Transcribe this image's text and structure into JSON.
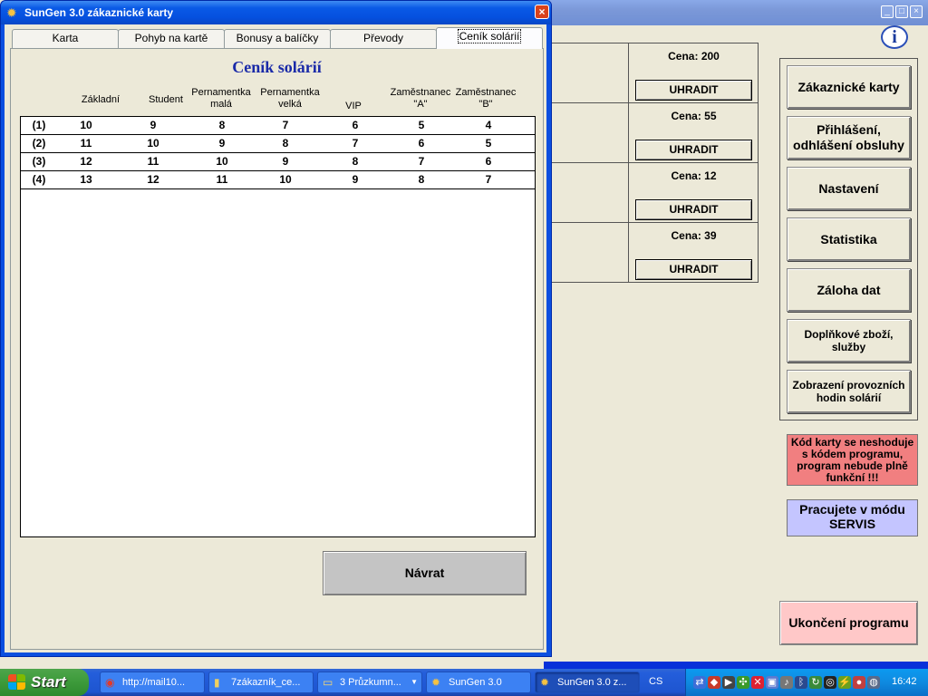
{
  "main_window": {
    "title_buttons": {
      "min": "_",
      "max": "□",
      "close": "×"
    },
    "info_button": "i",
    "prices": [
      {
        "price": "Cena: 200",
        "pay": "UHRADIT"
      },
      {
        "price": "Cena: 55",
        "pay": "UHRADIT"
      },
      {
        "price": "Cena: 12",
        "pay": "UHRADIT"
      },
      {
        "price": "Cena: 39",
        "pay": "UHRADIT"
      }
    ],
    "menu": [
      "Zákaznické karty",
      "Přihlášení, odhlášení obsluhy",
      "Nastavení",
      "Statistika",
      "Záloha dat",
      "Doplňkové zboží, služby",
      "Zobrazení provozních hodin solárií"
    ],
    "warning": "Kód karty se neshoduje s kódem programu, program nebude plně funkční !!!",
    "mode": "Pracujete v módu SERVIS",
    "quit": "Ukončení programu"
  },
  "dialog": {
    "title": "SunGen 3.0 zákaznické karty",
    "close": "×",
    "tabs": [
      "Karta",
      "Pohyb na kartě",
      "Bonusy a balíčky",
      "Převody",
      "Ceník solárií"
    ],
    "active_tab": "Ceník solárií",
    "panel_title": "Ceník solárií",
    "columns": [
      "Základní",
      "Student",
      "Pernamentka\nmalá",
      "Pernamentka\nvelká",
      "VIP",
      "Zaměstnanec\n\"A\"",
      "Zaměstnanec\n\"B\""
    ],
    "rows": [
      {
        "label": "(1)",
        "values": [
          "10",
          "9",
          "8",
          "7",
          "6",
          "5",
          "4"
        ]
      },
      {
        "label": "(2)",
        "values": [
          "11",
          "10",
          "9",
          "8",
          "7",
          "6",
          "5"
        ]
      },
      {
        "label": "(3)",
        "values": [
          "12",
          "11",
          "10",
          "9",
          "8",
          "7",
          "6"
        ]
      },
      {
        "label": "(4)",
        "values": [
          "13",
          "12",
          "11",
          "10",
          "9",
          "8",
          "7"
        ]
      }
    ],
    "back_button": "Návrat"
  },
  "taskbar": {
    "start": "Start",
    "buttons": [
      {
        "label": "http://mail10...",
        "icon": "browser-icon"
      },
      {
        "label": "7zákazník_ce...",
        "icon": "document-icon"
      },
      {
        "label": "3 Průzkumn...",
        "icon": "folder-icon"
      },
      {
        "label": "SunGen 3.0",
        "icon": "sungen-icon"
      },
      {
        "label": "SunGen 3.0 z...",
        "icon": "sungen-icon"
      }
    ],
    "language": "CS",
    "clock": "16:42"
  }
}
